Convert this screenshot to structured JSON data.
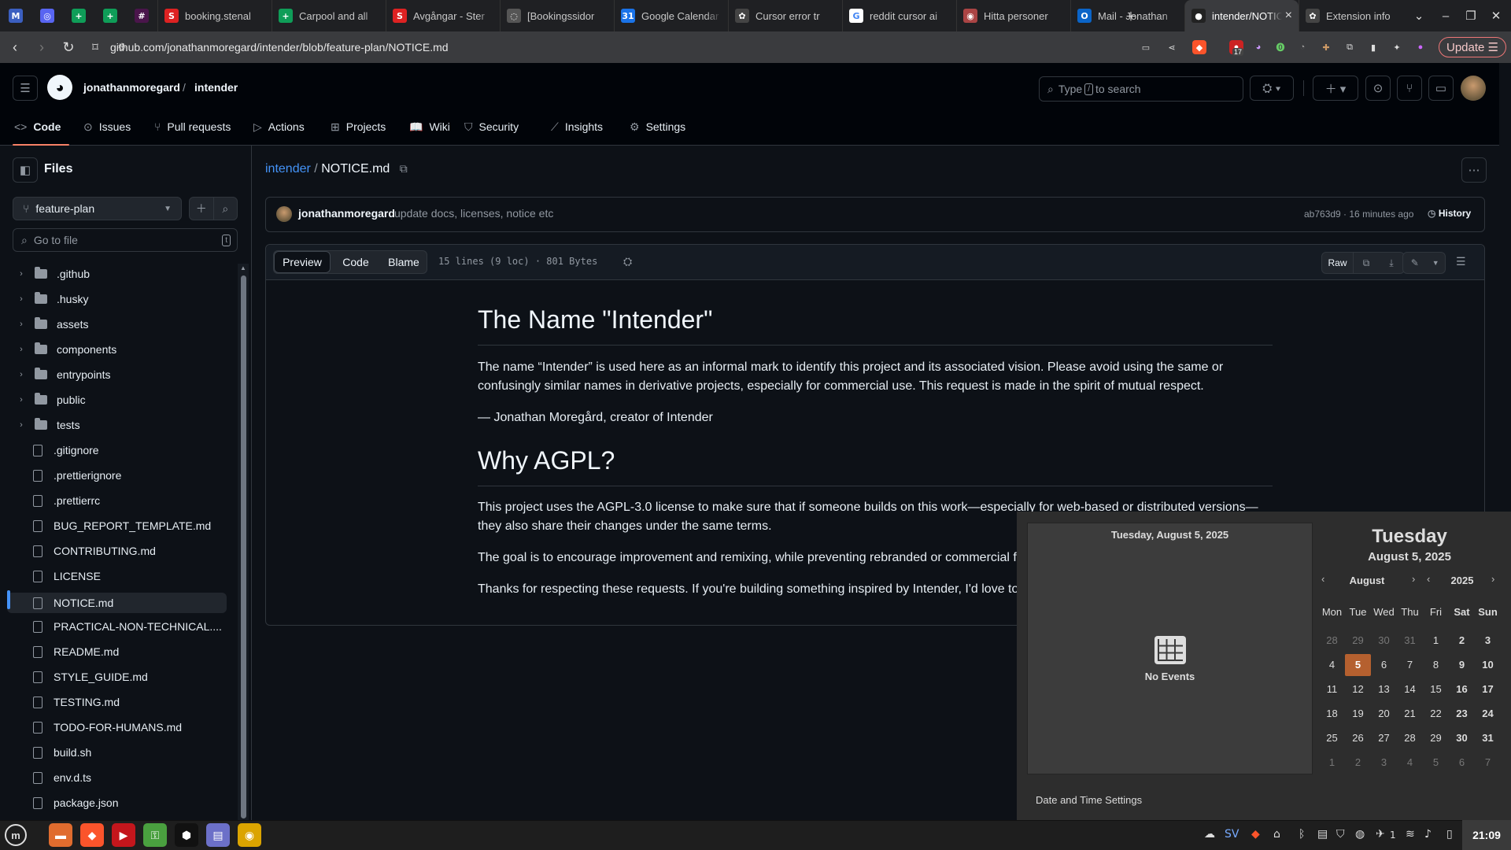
{
  "browser": {
    "pinned_tabs": [
      {
        "icon": "gmail-icon",
        "glyph": "M",
        "color": "#3b5fc0"
      },
      {
        "icon": "discord-icon",
        "glyph": "◎",
        "color": "#5865f2"
      },
      {
        "icon": "sheets-icon",
        "glyph": "+",
        "color": "#0f9d58"
      },
      {
        "icon": "sheets-icon",
        "glyph": "+",
        "color": "#0f9d58"
      },
      {
        "icon": "slack-icon",
        "glyph": "#",
        "color": "#4a154b"
      }
    ],
    "tabs": [
      {
        "title": "booking.stenal",
        "icon": "stena-icon",
        "glyph": "S",
        "color": "#d22"
      },
      {
        "title": "Carpool and all",
        "icon": "sheets-icon",
        "glyph": "+",
        "color": "#0f9d58"
      },
      {
        "title": "Avgångar - Ster",
        "icon": "stena-icon",
        "glyph": "S",
        "color": "#d22"
      },
      {
        "title": "[Bookingssidor",
        "icon": "page-icon",
        "glyph": "◌",
        "color": "#555"
      },
      {
        "title": "Google Calendar",
        "icon": "calendar-icon",
        "glyph": "31",
        "color": "#1a73e8"
      },
      {
        "title": "Cursor error tr",
        "icon": "chatgpt-icon",
        "glyph": "✿",
        "color": "#444"
      },
      {
        "title": "reddit cursor ai",
        "icon": "google-icon",
        "glyph": "G",
        "color": "#fff"
      },
      {
        "title": "Hitta personer",
        "icon": "hitta-icon",
        "glyph": "◉",
        "color": "#a44"
      },
      {
        "title": "Mail - Jonathan",
        "icon": "outlook-icon",
        "glyph": "O",
        "color": "#0a64c8"
      },
      {
        "title": "intender/NOTICE.md",
        "icon": "github-icon",
        "glyph": "●",
        "color": "#222",
        "active": true
      },
      {
        "title": "Extension info",
        "icon": "extension-icon",
        "glyph": "✿",
        "color": "#444"
      }
    ],
    "url": "github.com/jonathanmoregard/intender/blob/feature-plan/NOTICE.md",
    "update_label": "Update",
    "ext_badge": "17"
  },
  "github": {
    "owner": "jonathanmoregard",
    "repo": "intender",
    "search_placeholder_pre": "Type",
    "search_key": "/",
    "search_placeholder_post": "to search",
    "nav": [
      {
        "label": "Code",
        "icon": "code-icon",
        "glyph": "<>"
      },
      {
        "label": "Issues",
        "icon": "issue-icon",
        "glyph": "⊙"
      },
      {
        "label": "Pull requests",
        "icon": "pull-request-icon",
        "glyph": "⑂"
      },
      {
        "label": "Actions",
        "icon": "play-icon",
        "glyph": "▷"
      },
      {
        "label": "Projects",
        "icon": "table-icon",
        "glyph": "⊞"
      },
      {
        "label": "Wiki",
        "icon": "book-icon",
        "glyph": "📖"
      },
      {
        "label": "Security",
        "icon": "shield-icon",
        "glyph": "⛉"
      },
      {
        "label": "Insights",
        "icon": "graph-icon",
        "glyph": "⟋"
      },
      {
        "label": "Settings",
        "icon": "gear-icon",
        "glyph": "⚙"
      }
    ]
  },
  "sidebar": {
    "title": "Files",
    "branch": "feature-plan",
    "goto_placeholder": "Go to file",
    "goto_key": "t",
    "items": [
      {
        "name": ".github",
        "type": "dir"
      },
      {
        "name": ".husky",
        "type": "dir"
      },
      {
        "name": "assets",
        "type": "dir"
      },
      {
        "name": "components",
        "type": "dir"
      },
      {
        "name": "entrypoints",
        "type": "dir"
      },
      {
        "name": "public",
        "type": "dir"
      },
      {
        "name": "tests",
        "type": "dir"
      },
      {
        "name": ".gitignore",
        "type": "file"
      },
      {
        "name": ".prettierignore",
        "type": "file"
      },
      {
        "name": ".prettierrc",
        "type": "file"
      },
      {
        "name": "BUG_REPORT_TEMPLATE.md",
        "type": "file"
      },
      {
        "name": "CONTRIBUTING.md",
        "type": "file"
      },
      {
        "name": "LICENSE",
        "type": "file"
      },
      {
        "name": "NOTICE.md",
        "type": "file",
        "selected": true
      },
      {
        "name": "PRACTICAL-NON-TECHNICAL....",
        "type": "file"
      },
      {
        "name": "README.md",
        "type": "file"
      },
      {
        "name": "STYLE_GUIDE.md",
        "type": "file"
      },
      {
        "name": "TESTING.md",
        "type": "file"
      },
      {
        "name": "TODO-FOR-HUMANS.md",
        "type": "file"
      },
      {
        "name": "build.sh",
        "type": "file"
      },
      {
        "name": "env.d.ts",
        "type": "file"
      },
      {
        "name": "package.json",
        "type": "file"
      }
    ]
  },
  "file": {
    "repo_link": "intender",
    "sep": "/",
    "name": "NOTICE.md",
    "commit_author": "jonathanmoregard",
    "commit_message": "update docs, licenses, notice etc",
    "commit_meta": "ab763d9 · 16 minutes ago",
    "history_label": "History",
    "view_tabs": [
      "Preview",
      "Code",
      "Blame"
    ],
    "stats": "15 lines (9 loc) · 801 Bytes",
    "raw_label": "Raw"
  },
  "markdown": {
    "h1": "The Name \"Intender\"",
    "p1": "The name “Intender” is used here as an informal mark to identify this project and its associated vision. Please avoid using the same or confusingly similar names in derivative projects, especially for commercial use. This request is made in the spirit of mutual respect.",
    "p2": "— Jonathan Moregård, creator of Intender",
    "h2": "Why AGPL?",
    "p3": "This project uses the AGPL-3.0 license to make sure that if someone builds on this work—especially for web-based or distributed versions—they also share their changes under the same terms.",
    "p4": "The goal is to encourage improvement and remixing, while preventing rebranded or commercial f",
    "p5": "Thanks for respecting these requests. If you're building something inspired by Intender, I'd love to"
  },
  "calendar": {
    "events_header": "Tuesday, August 5, 2025",
    "no_events": "No Events",
    "day_name": "Tuesday",
    "date_label": "August 5, 2025",
    "month": "August",
    "year": "2025",
    "weekdays": [
      "Mon",
      "Tue",
      "Wed",
      "Thu",
      "Fri",
      "Sat",
      "Sun"
    ],
    "weeks": [
      [
        "28",
        "29",
        "30",
        "31",
        "1",
        "2",
        "3"
      ],
      [
        "4",
        "5",
        "6",
        "7",
        "8",
        "9",
        "10"
      ],
      [
        "11",
        "12",
        "13",
        "14",
        "15",
        "16",
        "17"
      ],
      [
        "18",
        "19",
        "20",
        "21",
        "22",
        "23",
        "24"
      ],
      [
        "25",
        "26",
        "27",
        "28",
        "29",
        "30",
        "31"
      ],
      [
        "1",
        "2",
        "3",
        "4",
        "5",
        "6",
        "7"
      ]
    ],
    "today": "5",
    "settings_label": "Date and Time Settings"
  },
  "taskbar": {
    "apps": [
      {
        "icon": "files-icon",
        "color": "#e06c2e"
      },
      {
        "icon": "brave-icon",
        "color": "#fb542b"
      },
      {
        "icon": "terminal-icon",
        "color": "#c4161c"
      },
      {
        "icon": "keyring-icon",
        "color": "#4aa03f"
      },
      {
        "icon": "cursor-icon",
        "color": "#111"
      },
      {
        "icon": "text-editor-icon",
        "color": "#6c70c8"
      },
      {
        "icon": "chrome-icon",
        "color": "#dba400"
      }
    ],
    "lang": "SV",
    "notif_count": "1",
    "clock": "21:09"
  }
}
